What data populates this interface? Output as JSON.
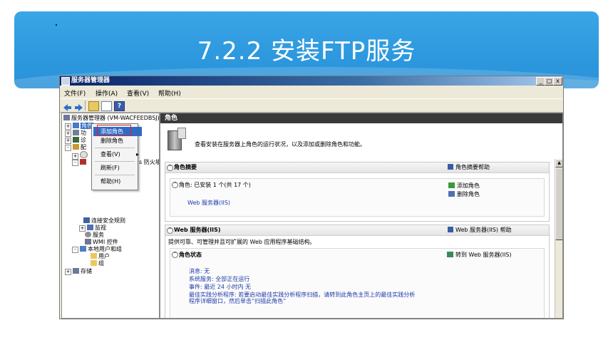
{
  "slide": {
    "title": "7.2.2 安装FTP服务"
  },
  "window": {
    "title": "服务器管理器",
    "menu": [
      "文件(F)",
      "操作(A)",
      "查看(V)",
      "帮助(H)"
    ]
  },
  "tree": {
    "root": "服务器管理器 (VM-WACFEEDBSJ)",
    "roles": "角色",
    "features": "功",
    "diagnostics": "诊",
    "config": "配",
    "firewall_suffix": "s 防火墙",
    "connection_security": "连接安全规则",
    "monitoring": "监视",
    "services": "服务",
    "wmi": "WMI 控件",
    "local_users": "本地用户和组",
    "users": "用户",
    "groups": "组",
    "storage": "存储"
  },
  "context_menu": {
    "add_role": "添加角色",
    "remove_role": "删除角色",
    "view": "查看(V)",
    "refresh": "刷新(F)",
    "help": "帮助(H)"
  },
  "right": {
    "header": "角色",
    "intro": "查看安装在服务器上角色的运行状况，以及添加或删除角色和功能。",
    "summary": {
      "title": "角色摘要",
      "help_link": "角色摘要帮助",
      "roles_line": "角色: 已安装 1 个(共 17 个)",
      "web_server": "Web 服务器(IIS)",
      "add_roles": "添加角色",
      "remove_roles": "删除角色"
    },
    "web": {
      "title": "Web 服务器(IIS)",
      "help_link": "Web 服务器(IIS) 帮助",
      "desc": "提供可靠、可管理并且可扩展的 Web 应用程序基础结构。",
      "status_title": "角色状态",
      "goto_link": "转到 Web 服务器(IIS)",
      "messages": "消息: 无",
      "system_services": "系统服务: 全部正在运行",
      "events": "事件: 最近 24 小时内 无",
      "bpa_line1": "最佳实践分析程序: 若要启动最佳实践分析程序扫描，请转到此角色主页上的最佳实践分析",
      "bpa_line2": "程序详细窗口，然后单击“扫描此角色”"
    }
  },
  "colors": {
    "banner": "#2d98de",
    "titlebar": "#0a246a",
    "selection": "#316ac5",
    "highlight_box": "#e02020"
  }
}
